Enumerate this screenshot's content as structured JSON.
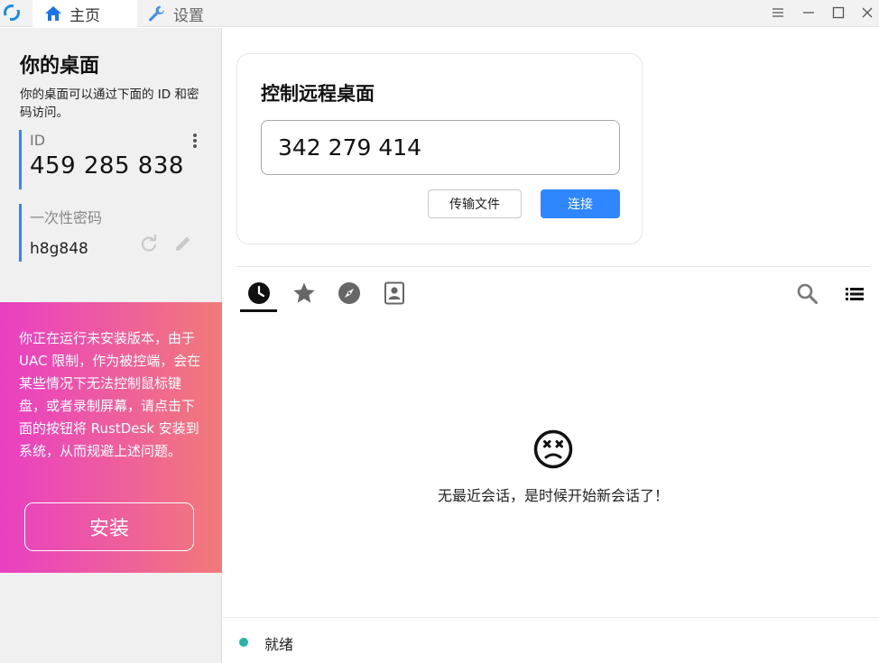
{
  "titlebar": {
    "tabs": [
      {
        "label": "主页",
        "icon": "home-icon"
      },
      {
        "label": "设置",
        "icon": "wrench-icon"
      }
    ]
  },
  "left": {
    "title": "你的桌面",
    "description": "你的桌面可以通过下面的 ID 和密码访问。",
    "id_label": "ID",
    "id_value": "459 285 838",
    "password_label": "一次性密码",
    "password_value": "h8g848",
    "warning": "你正在运行未安装版本，由于 UAC 限制，作为被控端，会在某些情况下无法控制鼠标键盘，或者录制屏幕，请点击下面的按钮将 RustDesk 安装到系统，从而规避上述问题。",
    "install_label": "安装"
  },
  "connect": {
    "title": "控制远程桌面",
    "remote_id": "342 279 414",
    "transfer_label": "传输文件",
    "connect_label": "连接"
  },
  "peers": {
    "tabs": [
      "clock-icon",
      "star-icon",
      "compass-icon",
      "address-book-icon"
    ],
    "empty_text": "无最近会话，是时候开始新会话了！"
  },
  "status": {
    "text": "就绪",
    "color": "#25b6a3"
  },
  "colors": {
    "accent": "#2e87ff",
    "warn_gradient_start": "#e93fc3",
    "warn_gradient_end": "#f27a79"
  }
}
